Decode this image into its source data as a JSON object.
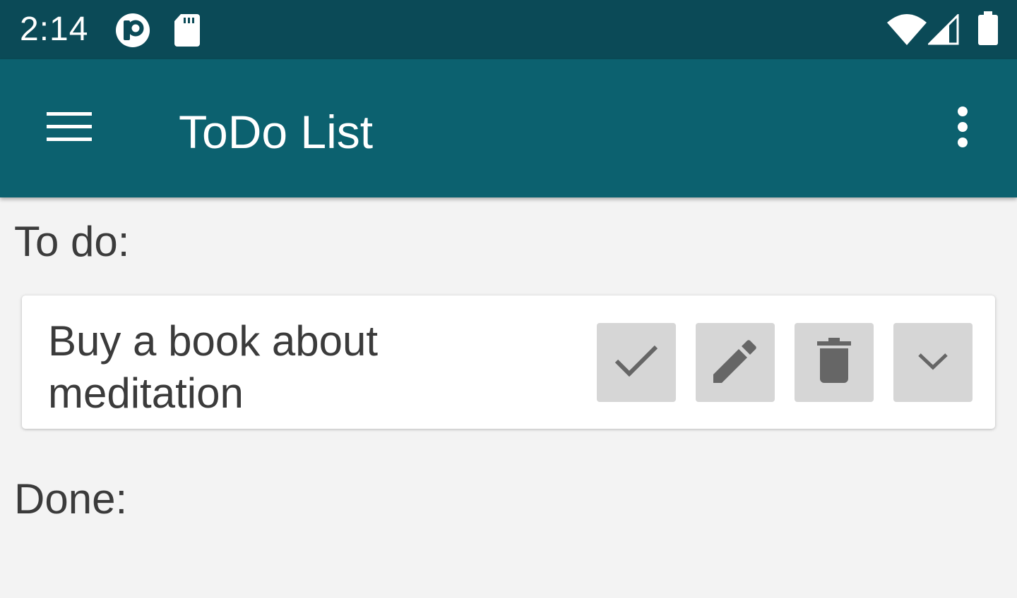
{
  "status_bar": {
    "time": "2:14",
    "icons": [
      "notification-app-icon",
      "sd-card-icon",
      "wifi-icon",
      "cell-signal-icon",
      "battery-icon"
    ],
    "background": "#0b4a57"
  },
  "app_bar": {
    "title": "ToDo List",
    "menu_icon": "hamburger-menu-icon",
    "overflow_icon": "more-vert-icon",
    "background": "#0c616f"
  },
  "todo_section": {
    "label": "To do:",
    "items": [
      {
        "text": "Buy a book about meditation",
        "actions": [
          {
            "name": "complete",
            "icon": "check-icon"
          },
          {
            "name": "edit",
            "icon": "pencil-icon"
          },
          {
            "name": "delete",
            "icon": "trash-icon"
          },
          {
            "name": "expand",
            "icon": "chevron-down-icon"
          }
        ]
      }
    ]
  },
  "done_section": {
    "label": "Done:",
    "items": []
  },
  "colors": {
    "page_background": "#f3f3f3",
    "button_background": "#d6d6d6",
    "icon_gray": "#666666",
    "text": "#3b3b3b"
  }
}
